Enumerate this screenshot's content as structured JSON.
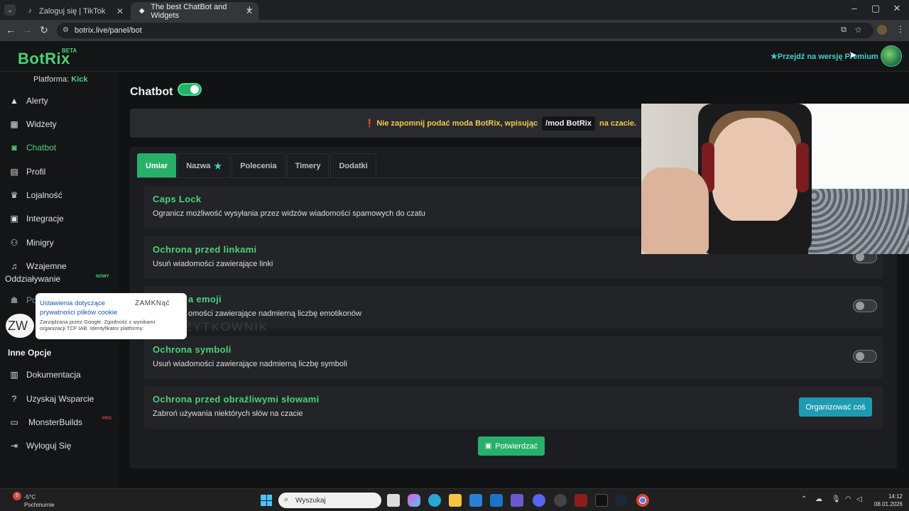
{
  "browser": {
    "tabs": [
      {
        "title": "Zaloguj się | TikTok",
        "favicon": "tiktok-icon"
      },
      {
        "title": "The best ChatBot and Widgets",
        "favicon": "botrix-icon"
      }
    ],
    "new_tab": "+",
    "url": "botrix.live/panel/bot"
  },
  "header": {
    "logo": "BotRix",
    "beta": "BETA",
    "premium_link": "Przejdź na wersję Premium"
  },
  "sidebar": {
    "platform_label": "Platforma:",
    "platform_value": "Kick",
    "items": [
      {
        "label": "Alerty",
        "icon": "warning-icon"
      },
      {
        "label": "Widżety",
        "icon": "grid-icon"
      },
      {
        "label": "Chatbot",
        "icon": "robot-icon"
      },
      {
        "label": "Profil",
        "icon": "id-card-icon"
      },
      {
        "label": "Lojalność",
        "icon": "trophy-icon"
      },
      {
        "label": "Integracje",
        "icon": "plug-icon"
      },
      {
        "label": "Minigry",
        "icon": "gamepad-icon"
      },
      {
        "label": "Wzajemne",
        "icon": "music-icon"
      },
      {
        "label": "Oddziaływanie",
        "icon": ""
      },
      {
        "label": "Po",
        "icon": "users-icon"
      }
    ],
    "new_badge": "NOWY",
    "section_other": "Inne Opcje",
    "other_items": [
      {
        "label": "Dokumentacja",
        "icon": "book-icon"
      },
      {
        "label": "Uzyskaj Wsparcie",
        "icon": "help-icon"
      },
      {
        "label": "MonsterBuilds",
        "icon": "laptop-icon"
      },
      {
        "label": "Wyloguj Się",
        "icon": "logout-icon"
      }
    ],
    "pro_badge": "PRO"
  },
  "cookie_popup": {
    "title": "Ustawienia dotyczące prywatności plików cookie",
    "close": "ZAMKNąć",
    "sub": "Zarządzana przez Google. Zgodność z wynikami organizacji TCF IAB. Identyfikator platformy:",
    "zw": "ZW",
    "ghost": "UŻYTKOWNIK"
  },
  "main": {
    "title": "Chatbot",
    "notice": {
      "text_before": "Nie zapomnij podać moda BotRix, wpisując",
      "code": "/mod BotRix",
      "text_after": "na czacie."
    },
    "tabs": [
      {
        "label": "Umiar",
        "active": true
      },
      {
        "label": "Nazwa",
        "star": true
      },
      {
        "label": "Polecenia"
      },
      {
        "label": "Timery"
      },
      {
        "label": "Dodatki"
      }
    ],
    "rules": [
      {
        "title": "Caps Lock",
        "desc": "Ogranicz możliwość wysyłania przez widzów wiadomości spamowych do czatu"
      },
      {
        "title": "Ochrona przed linkami",
        "desc": "Usuń wiadomości zawierające linki"
      },
      {
        "title": "a emoji",
        "desc": "omości zawierające nadmierną liczbę emotikonów"
      },
      {
        "title": "Ochrona symboli",
        "desc": "Usuń wiadomości zawierające nadmierną liczbę symboli"
      },
      {
        "title": "Ochrona przed obraźliwymi słowami",
        "desc": "Zabroń używania niektórych słów na czacie"
      }
    ],
    "organize_button": "Organizować coś",
    "save_button": "Potwierdzać"
  },
  "taskbar": {
    "weather_temp": "-5°C",
    "weather_desc": "Pochmurnie",
    "weather_badge": "5",
    "search_placeholder": "Wyszukaj",
    "time": "14:12",
    "date": "08.01.2026"
  },
  "colors": {
    "accent_green": "#4cd17a",
    "teal": "#3fd3c5",
    "notice_yellow": "#f2c94c",
    "button_blue": "#1e9bb0"
  }
}
